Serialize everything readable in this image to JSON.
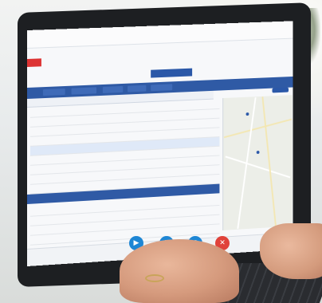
{
  "scene": {
    "description_tags": [
      "laptop-photo",
      "scheduling-dashboard"
    ],
    "colors": {
      "header_blue": "#2f5aa5",
      "fab_blue": "#1e86d4",
      "fab_red": "#e0423a",
      "map_bg": "#eceee8"
    }
  },
  "app": {
    "title": "",
    "toolbar_items": [
      "",
      "",
      "",
      "",
      "",
      ""
    ],
    "fab_icons": [
      "video-icon",
      "chart-icon",
      "chat-icon",
      "close-icon"
    ],
    "fab_glyphs": [
      "▶",
      "▮",
      "●",
      "✕"
    ]
  }
}
